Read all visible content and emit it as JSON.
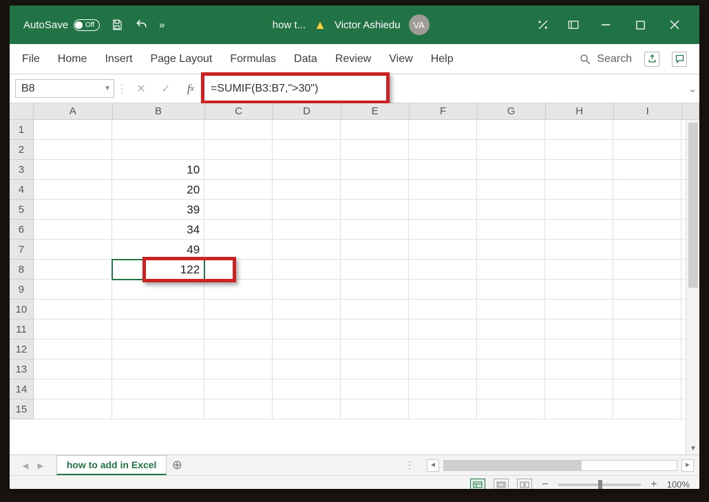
{
  "titlebar": {
    "autosave_label": "AutoSave",
    "autosave_state": "Off",
    "doc_title": "how t...",
    "user_name": "Victor Ashiedu",
    "user_initials": "VA"
  },
  "ribbon": {
    "tabs": [
      "File",
      "Home",
      "Insert",
      "Page Layout",
      "Formulas",
      "Data",
      "Review",
      "View",
      "Help"
    ],
    "search_label": "Search"
  },
  "formula_bar": {
    "name_box": "B8",
    "formula": "=SUMIF(B3:B7,\">30\")"
  },
  "grid": {
    "columns": [
      "A",
      "B",
      "C",
      "D",
      "E",
      "F",
      "G",
      "H",
      "I"
    ],
    "rows": [
      "1",
      "2",
      "3",
      "4",
      "5",
      "6",
      "7",
      "8",
      "9",
      "10",
      "11",
      "12",
      "13",
      "14",
      "15"
    ],
    "cells": {
      "B3": "10",
      "B4": "20",
      "B5": "39",
      "B6": "34",
      "B7": "49",
      "B8": "122"
    },
    "selected": "B8"
  },
  "sheet_tabs": {
    "active": "how to add in Excel"
  },
  "status": {
    "zoom": "100%"
  }
}
